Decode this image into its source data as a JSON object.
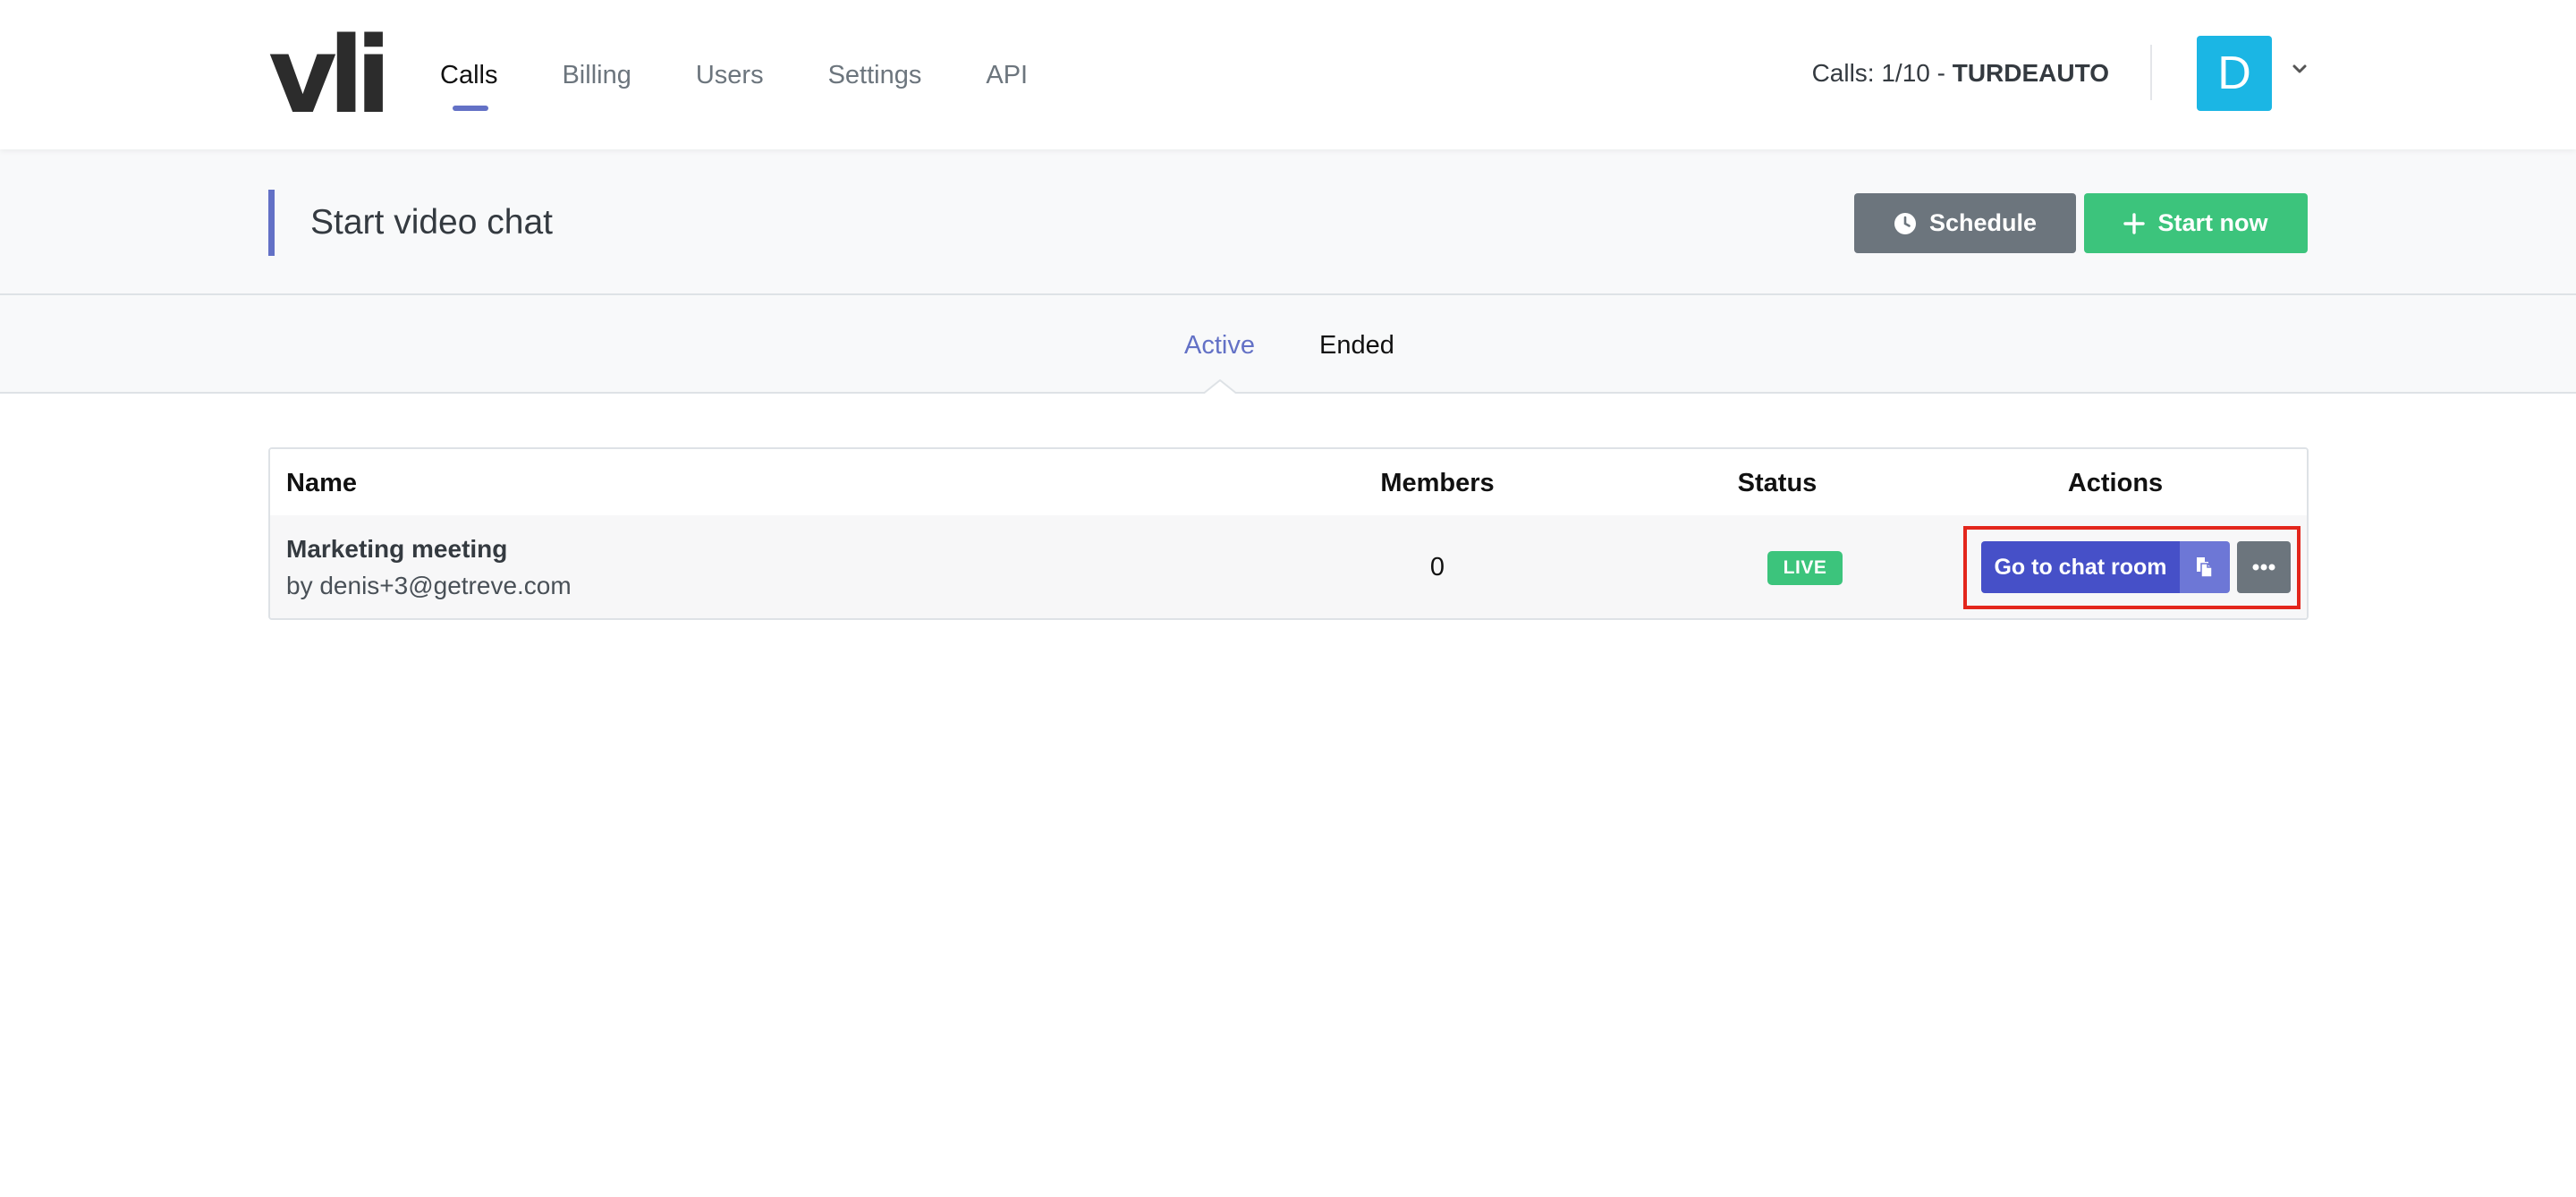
{
  "brand": {
    "logo_text": "vli"
  },
  "nav": {
    "items": [
      {
        "label": "Calls",
        "active": true
      },
      {
        "label": "Billing"
      },
      {
        "label": "Users"
      },
      {
        "label": "Settings"
      },
      {
        "label": "API"
      }
    ]
  },
  "usage": {
    "label": "Calls: 1/10 - ",
    "account": "TURDEAUTO"
  },
  "user": {
    "avatar_letter": "D"
  },
  "header": {
    "title": "Start video chat",
    "schedule_label": "Schedule",
    "start_now_label": "Start now"
  },
  "tabs": [
    {
      "label": "Active",
      "active": true
    },
    {
      "label": "Ended"
    }
  ],
  "table": {
    "columns": [
      "Name",
      "Members",
      "Status",
      "Actions"
    ],
    "rows": [
      {
        "name": "Marketing meeting",
        "owner": "by denis+3@getreve.com",
        "members": "0",
        "status": "LIVE",
        "action_label": "Go to chat room"
      }
    ]
  },
  "colors": {
    "accent": "#6371c6",
    "primary_button": "#4650c8",
    "success": "#3cc47c",
    "secondary": "#6c757d",
    "avatar": "#1bb6e4",
    "highlight": "#e3261c"
  },
  "icons": {
    "schedule": "clock-icon",
    "start": "plus-icon",
    "copy": "copy-icon",
    "more": "ellipsis-icon",
    "caret": "chevron-down-icon"
  }
}
